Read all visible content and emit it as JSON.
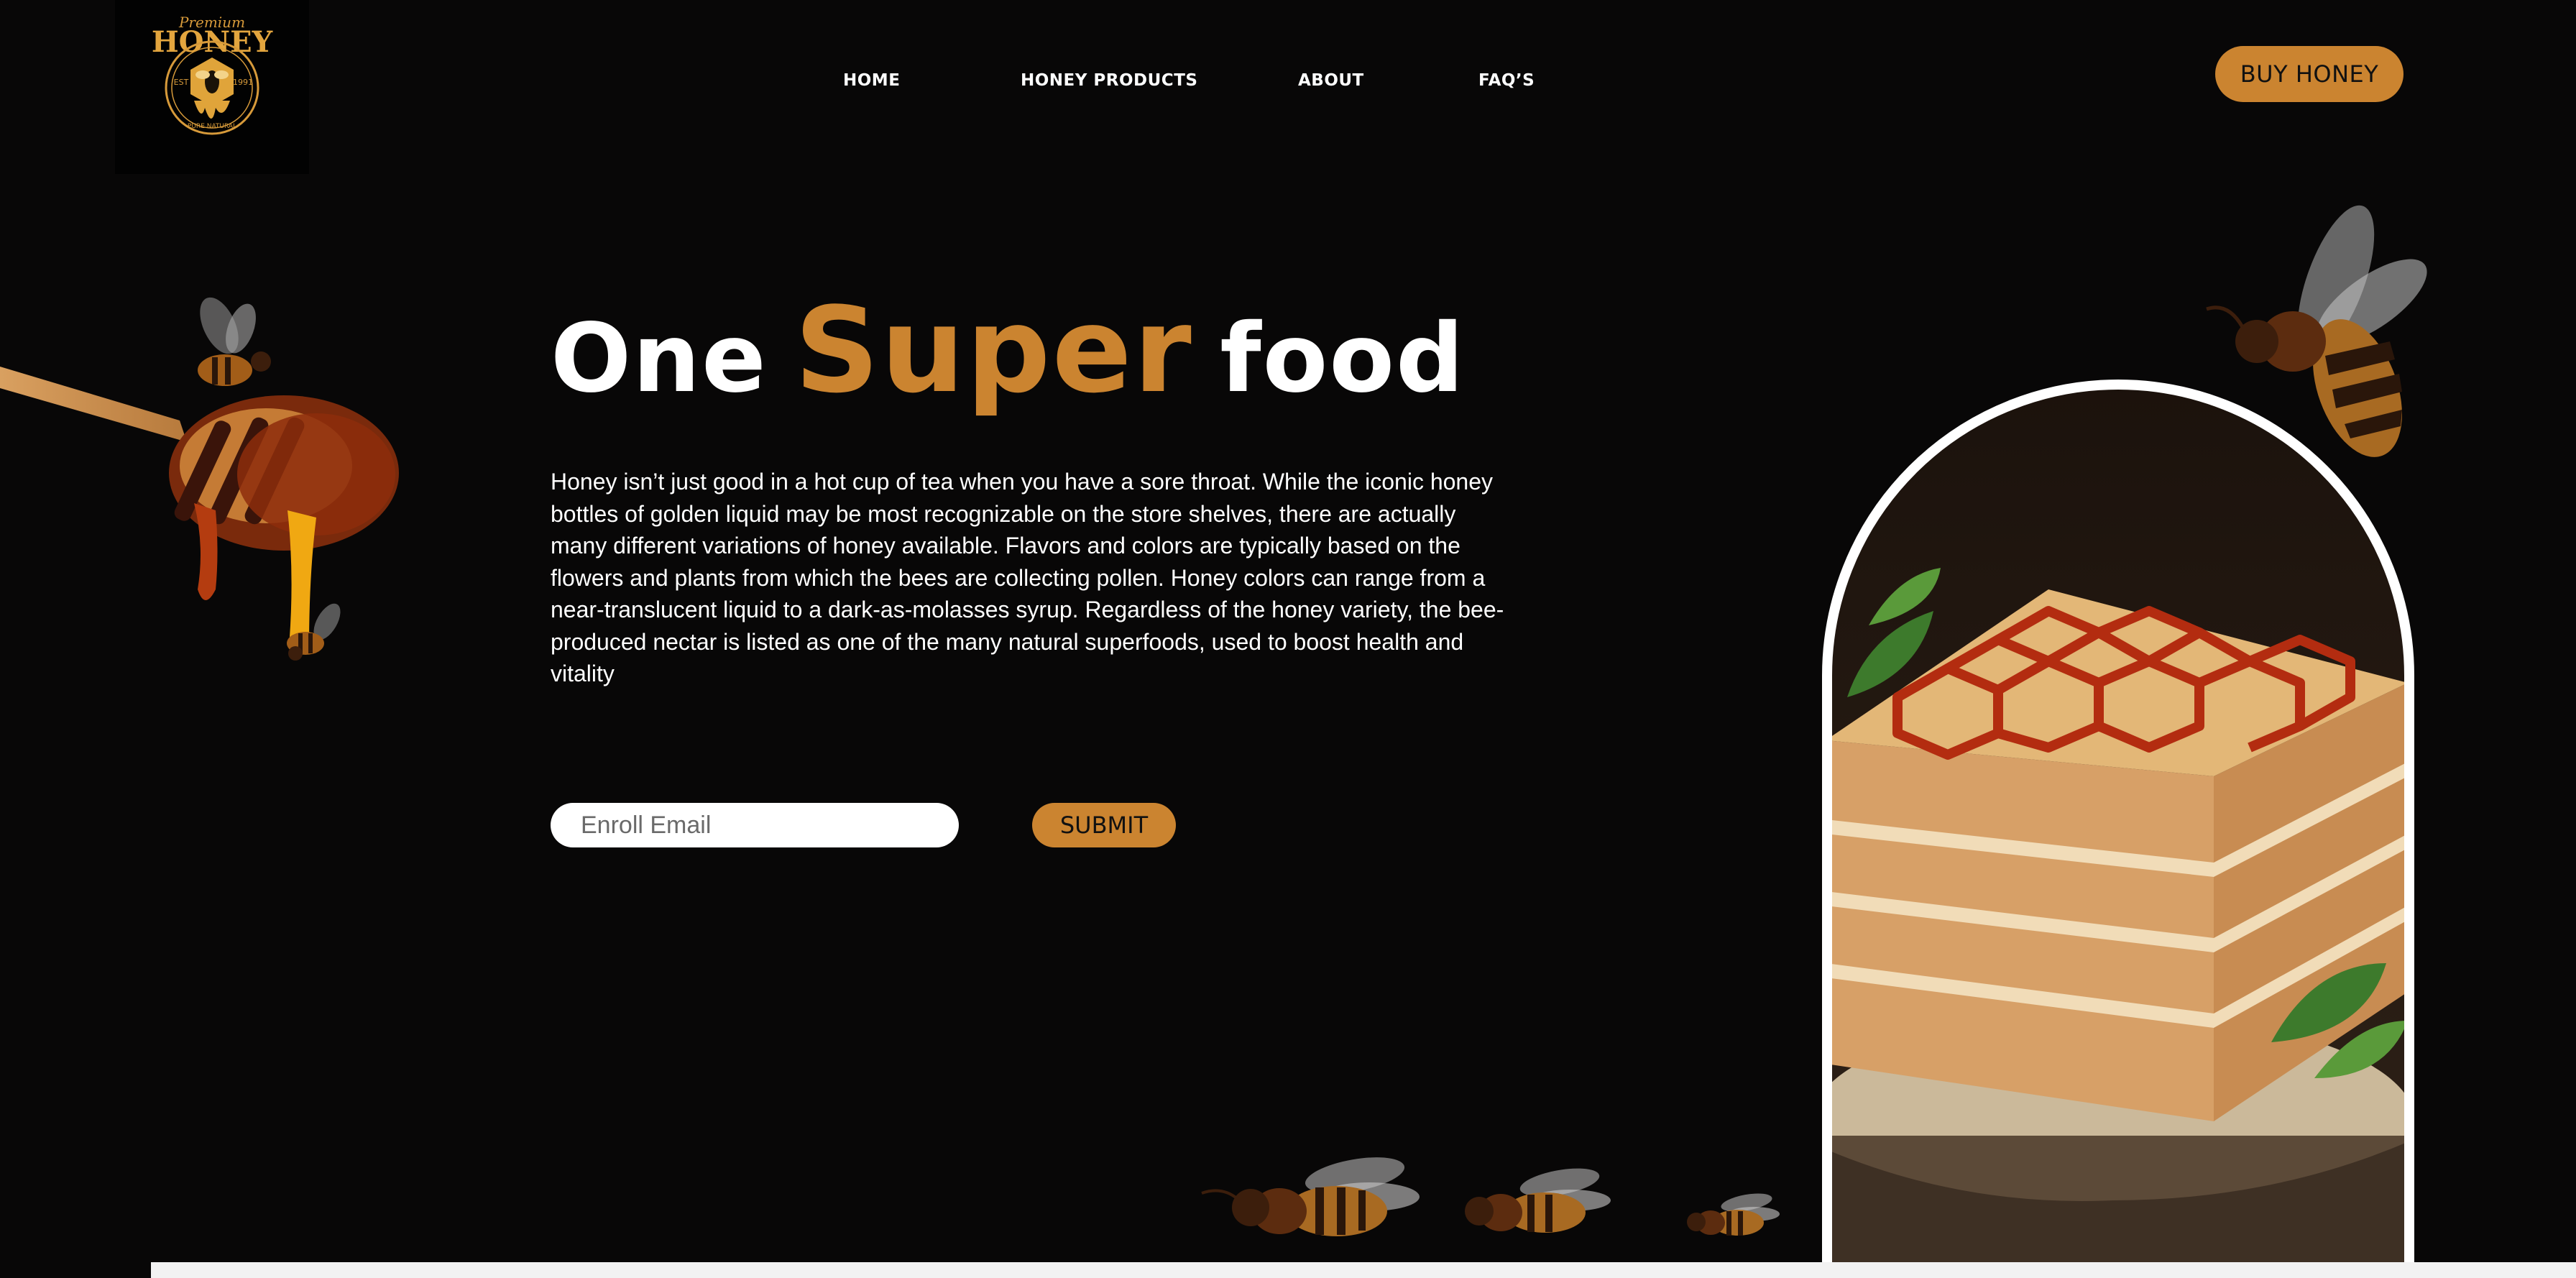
{
  "logo": {
    "script_text": "Premium",
    "title": "HONEY",
    "left_year": "EST",
    "right_year": "1991",
    "ribbon": "PURE NATURAL"
  },
  "nav": {
    "items": [
      {
        "label": "HOME"
      },
      {
        "label": "HONEY PRODUCTS"
      },
      {
        "label": "ABOUT"
      },
      {
        "label": "FAQ’S"
      }
    ],
    "cta_label": "BUY HONEY"
  },
  "hero": {
    "title_part1": "One",
    "title_highlight": "Super",
    "title_part2": "food",
    "body": "Honey isn’t just good in a hot cup of tea when you have a sore throat. While the iconic honey bottles of golden liquid may be most recognizable on the store shelves, there are actually many different variations of honey available. Flavors and colors are typically based on the flowers and plants from which the bees are collecting pollen. Honey colors can range from a near-translucent liquid to a dark-as-molasses syrup. Regardless of the honey variety, the bee-produced nectar is listed as one of the many natural superfoods, used to boost health and vitality"
  },
  "signup": {
    "placeholder": "Enroll Email",
    "submit_label": "SUBMIT"
  },
  "colors": {
    "background": "#080707",
    "accent": "#cb8430",
    "text": "#ffffff"
  },
  "icons": [
    "logo-icon",
    "honey-dipper-icon",
    "bee-icon",
    "honey-cake-icon"
  ]
}
